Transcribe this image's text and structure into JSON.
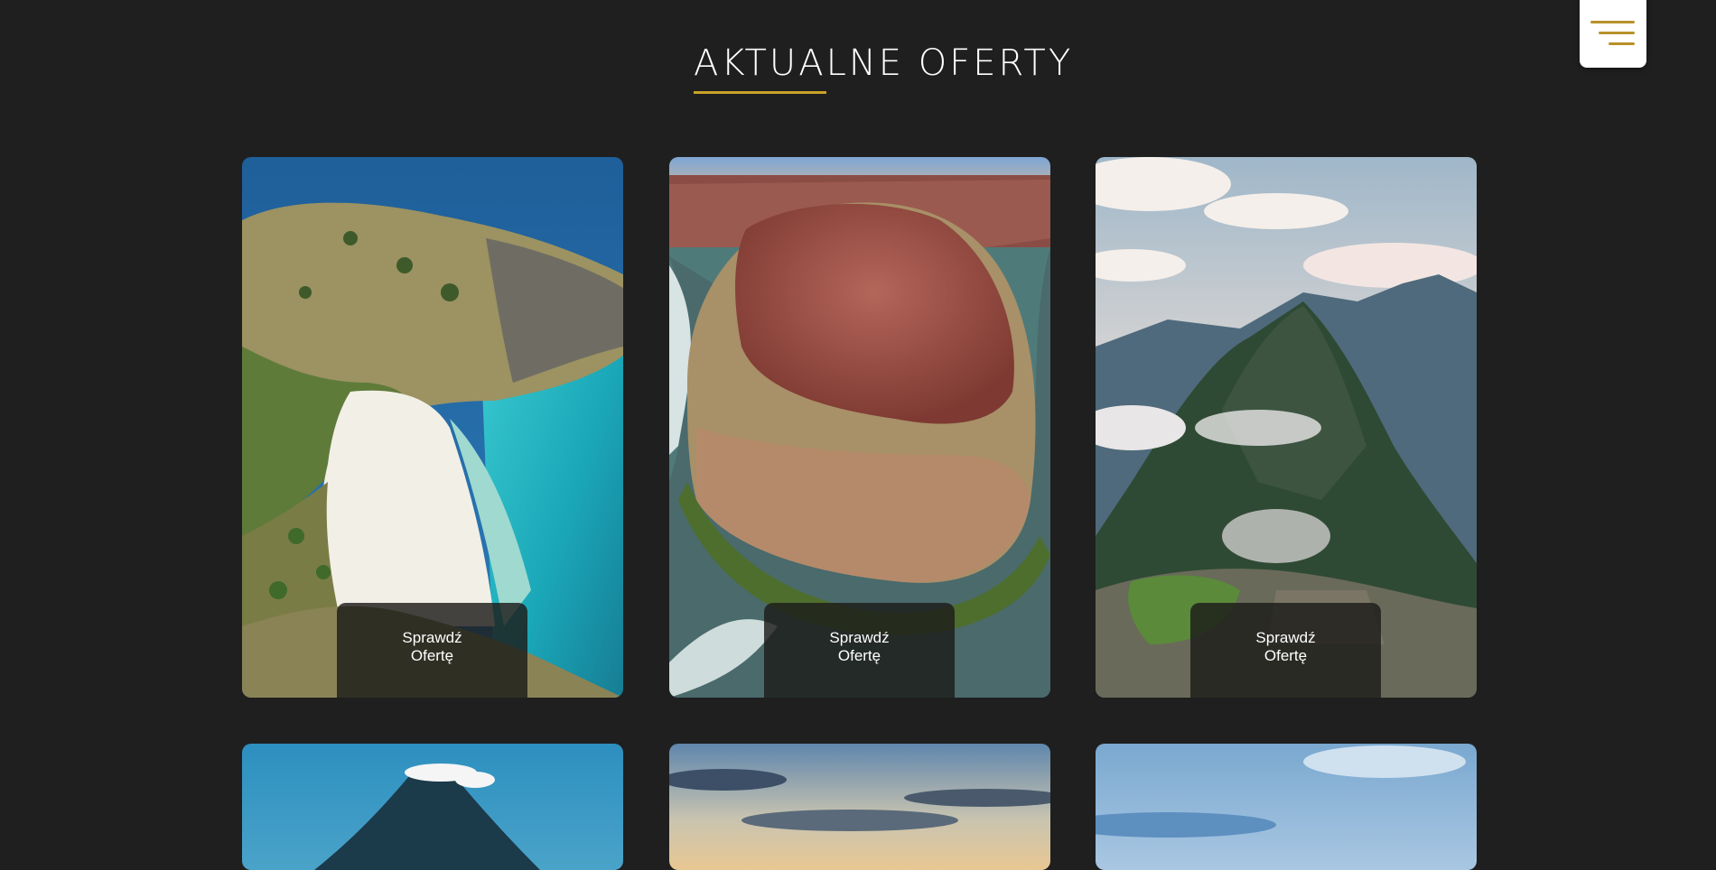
{
  "header": {
    "title": "AKTUALNE OFERTY"
  },
  "menu": {
    "icon": "hamburger-menu-icon",
    "accent_color": "#b8912a"
  },
  "colors": {
    "background": "#1f1f1f",
    "accent": "#c9a227"
  },
  "offers": [
    {
      "image": "tropical-island-beach",
      "button_line1": "Sprawdź",
      "button_line2": "Ofertę"
    },
    {
      "image": "horseshoe-bend-canyon",
      "button_line1": "Sprawdź",
      "button_line2": "Ofertę"
    },
    {
      "image": "machu-picchu-mountains",
      "button_line1": "Sprawdź",
      "button_line2": "Ofertę"
    },
    {
      "image": "volcano-peak"
    },
    {
      "image": "sunset-sky"
    },
    {
      "image": "blue-sky-landscape"
    }
  ]
}
